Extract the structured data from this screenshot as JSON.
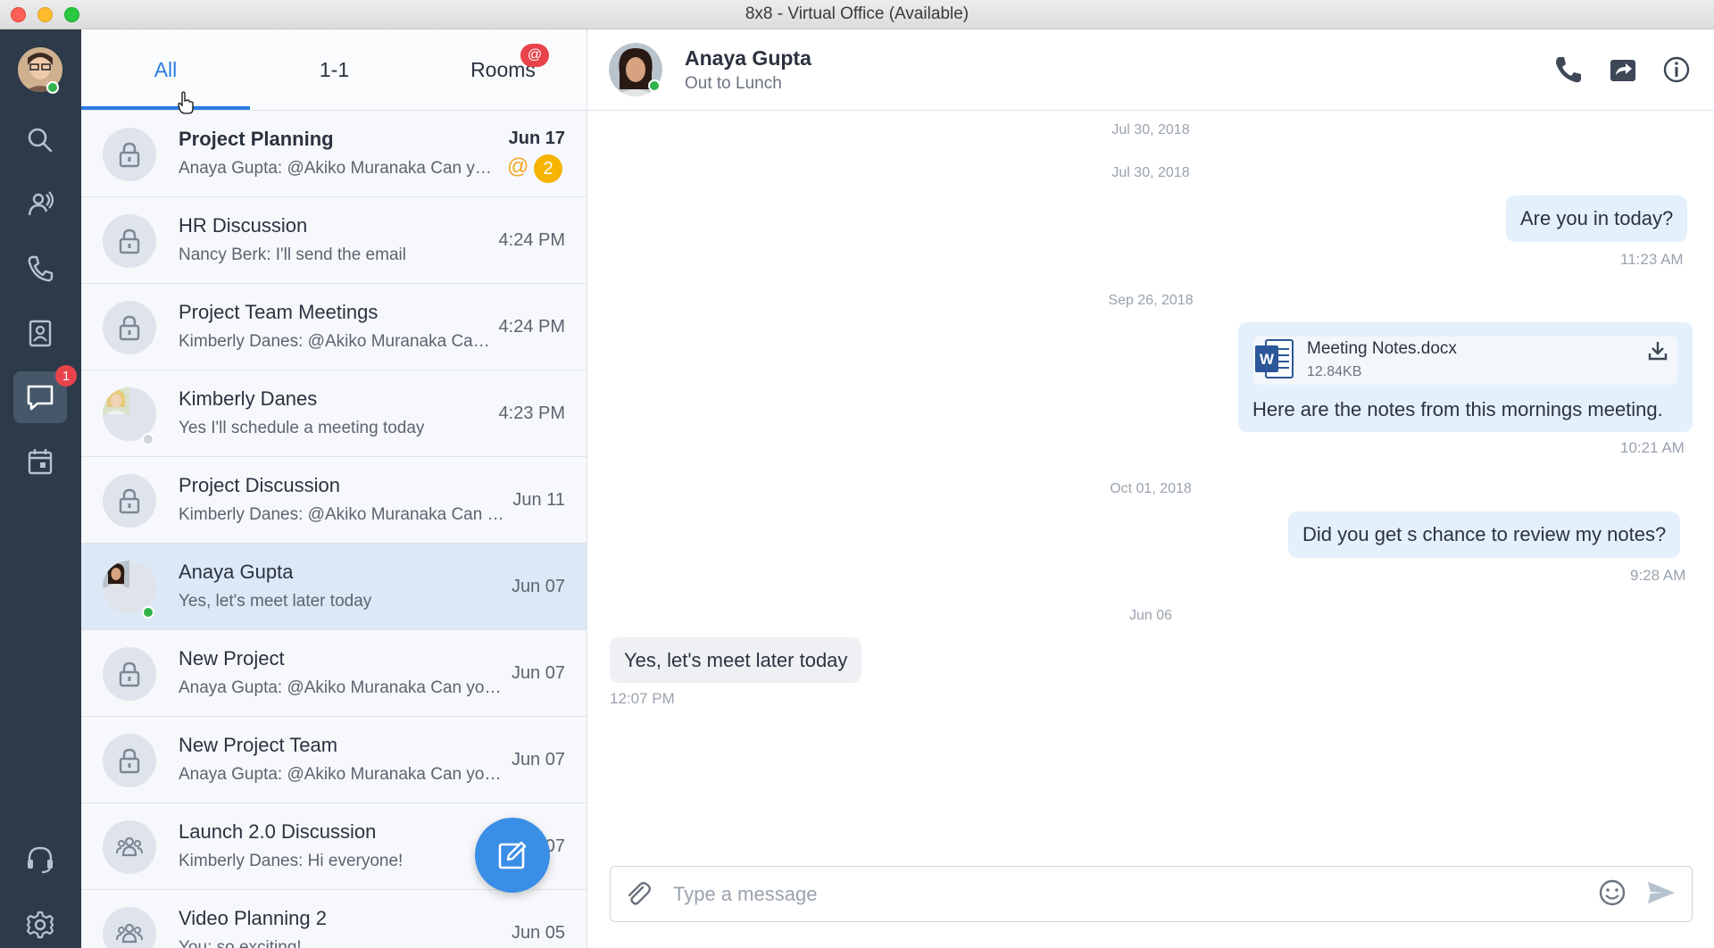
{
  "window": {
    "title": "8x8 - Virtual Office (Available)"
  },
  "rail": {
    "items": [
      {
        "name": "search-icon"
      },
      {
        "name": "team-icon"
      },
      {
        "name": "phone-icon"
      },
      {
        "name": "contacts-icon"
      },
      {
        "name": "chat-icon",
        "badge": "1"
      },
      {
        "name": "calendar-icon"
      }
    ],
    "bottom": [
      {
        "name": "headset-icon"
      },
      {
        "name": "gear-icon"
      }
    ]
  },
  "tabs": {
    "all": "All",
    "one_on_one": "1-1",
    "rooms": "Rooms",
    "rooms_badge": "@"
  },
  "conversations": [
    {
      "name": "Project Planning",
      "preview": "Anaya Gupta: @Akiko Muranaka Can you please...",
      "time": "Jun 17",
      "mention": "@",
      "count": "2"
    },
    {
      "name": "HR Discussion",
      "preview": "Nancy Berk: I'll send the email",
      "time": "4:24 PM"
    },
    {
      "name": "Project Team Meetings",
      "preview": "Kimberly Danes: @Akiko Muranaka Can you...",
      "time": "4:24 PM"
    },
    {
      "name": "Kimberly Danes",
      "preview": "Yes I'll schedule a meeting today",
      "time": "4:23 PM"
    },
    {
      "name": "Project Discussion",
      "preview": "Kimberly Danes: @Akiko Muranaka Can you...",
      "time": "Jun 11"
    },
    {
      "name": "Anaya Gupta",
      "preview": "Yes, let's meet later today",
      "time": "Jun 07"
    },
    {
      "name": "New Project",
      "preview": "Anaya Gupta: @Akiko Muranaka Can you please...",
      "time": "Jun 07"
    },
    {
      "name": "New Project Team",
      "preview": "Anaya Gupta: @Akiko Muranaka Can you please...",
      "time": "Jun 07"
    },
    {
      "name": "Launch 2.0 Discussion",
      "preview": "Kimberly Danes: Hi everyone!",
      "time": "Jun 07"
    },
    {
      "name": "Video Planning 2",
      "preview": "You: so exciting!",
      "time": "Jun 05"
    }
  ],
  "chat": {
    "name": "Anaya Gupta",
    "status": "Out to Lunch",
    "dates": [
      "Jul 30, 2018",
      "Jul 30, 2018",
      "Sep 26, 2018",
      "Oct 01, 2018",
      "Jun 06"
    ],
    "messages": [
      {
        "text": "Are you in today?",
        "time": "11:23 AM"
      },
      {
        "text": "Here are the notes from this mornings meeting.",
        "time": "10:21 AM",
        "file_name": "Meeting Notes.docx",
        "file_size": "12.84KB"
      },
      {
        "text": "Did you get s chance to review my notes?",
        "time": "9:28 AM"
      },
      {
        "text": "Yes, let's meet later today",
        "time": "12:07 PM"
      }
    ],
    "composer_placeholder": "Type a message"
  },
  "colors": {
    "accent": "#2a7de1",
    "rail": "#2d3a49",
    "badge": "#e8434a",
    "online": "#2fb34a",
    "outgoing_bubble": "#e4f0fb"
  }
}
